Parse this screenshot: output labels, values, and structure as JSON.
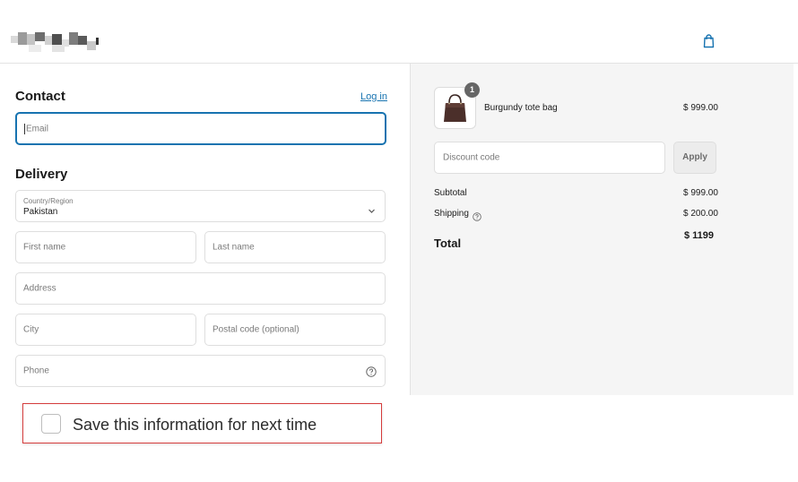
{
  "header": {
    "logo_icon": "blurred-store-logo",
    "cart_icon": "shopping-bag-icon"
  },
  "contact": {
    "title": "Contact",
    "login_link": "Log in",
    "email": {
      "placeholder": "Email",
      "value": ""
    }
  },
  "delivery": {
    "title": "Delivery",
    "country": {
      "label": "Country/Region",
      "value": "Pakistan",
      "icon": "chevron-down-icon"
    },
    "first_name": {
      "placeholder": "First name"
    },
    "last_name": {
      "placeholder": "Last name"
    },
    "address": {
      "placeholder": "Address"
    },
    "city": {
      "placeholder": "City"
    },
    "postal_code": {
      "placeholder": "Postal code (optional)"
    },
    "phone": {
      "placeholder": "Phone",
      "icon": "help-circle-icon"
    }
  },
  "save_info": {
    "label": "Save this information for next time",
    "checked": false
  },
  "order_summary": {
    "item": {
      "name": "Burgundy tote bag",
      "price": "$ 999.00",
      "quantity": "1",
      "thumbnail": "tote-bag-image"
    },
    "discount": {
      "placeholder": "Discount code",
      "apply_label": "Apply"
    },
    "subtotal": {
      "label": "Subtotal",
      "value": "$ 999.00"
    },
    "shipping": {
      "label": "Shipping",
      "value": "$ 200.00",
      "icon": "help-circle-icon"
    },
    "total": {
      "label": "Total",
      "value": "$ 1199"
    }
  },
  "colors": {
    "accent": "#1773b0",
    "highlight_border": "#d53c3c",
    "panel_bg": "#f5f5f5"
  }
}
